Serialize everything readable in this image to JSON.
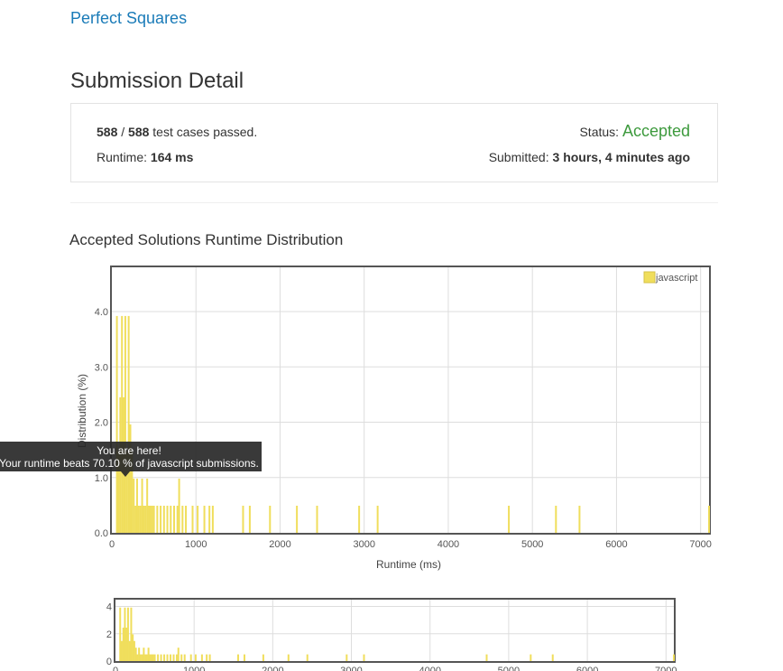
{
  "problem": {
    "title": "Perfect Squares"
  },
  "page_title": "Submission Detail",
  "summary": {
    "passed": "588",
    "slash": " / ",
    "total": "588",
    "passed_suffix": " test cases passed.",
    "runtime_label": "Runtime: ",
    "runtime_value": "164 ms",
    "status_label": "Status: ",
    "status_value": "Accepted",
    "submitted_label": "Submitted: ",
    "submitted_value": "3 hours, 4 minutes ago"
  },
  "colors": {
    "bar": "#f0de5c",
    "link": "#1a7bb8",
    "accepted": "#3d9a3d"
  },
  "distribution_title": "Accepted Solutions Runtime Distribution",
  "tooltip": {
    "line1": "You are here!",
    "line2": "Your runtime beats 70.10 % of javascript submissions."
  },
  "chart_data": [
    {
      "type": "bar",
      "xlabel": "Runtime (ms)",
      "ylabel": "Distribution (%)",
      "xlim": [
        0,
        7100
      ],
      "ylim": [
        0,
        4.8
      ],
      "xticks": [
        0,
        1000,
        2000,
        3000,
        4000,
        5000,
        6000,
        7000
      ],
      "yticks": [
        0.0,
        1.0,
        2.0,
        3.0,
        4.0
      ],
      "ytick_labels": [
        "0.0",
        "1.0",
        "2.0",
        "3.0",
        "4.0"
      ],
      "grid": true,
      "legend": "top-right",
      "series": [
        {
          "name": "javascript",
          "x": [
            60,
            80,
            100,
            120,
            140,
            160,
            180,
            200,
            220,
            240,
            260,
            280,
            300,
            320,
            340,
            360,
            380,
            400,
            420,
            440,
            460,
            480,
            500,
            540,
            580,
            620,
            660,
            700,
            740,
            780,
            800,
            840,
            880,
            960,
            1020,
            1100,
            1160,
            1200,
            1560,
            1640,
            1880,
            2200,
            2440,
            2940,
            3160,
            4720,
            5280,
            5560,
            7100
          ],
          "values": [
            3.92,
            1.47,
            2.45,
            3.92,
            2.45,
            3.92,
            1.47,
            3.92,
            1.96,
            1.47,
            0.98,
            0.49,
            0.98,
            0.49,
            0.49,
            0.98,
            0.49,
            0.49,
            0.98,
            0.49,
            0.49,
            0.49,
            0.49,
            0.49,
            0.49,
            0.49,
            0.49,
            0.49,
            0.49,
            0.49,
            0.98,
            0.49,
            0.49,
            0.49,
            0.49,
            0.49,
            0.49,
            0.49,
            0.49,
            0.49,
            0.49,
            0.49,
            0.49,
            0.49,
            0.49,
            0.49,
            0.49,
            0.49,
            0.49
          ]
        }
      ]
    },
    {
      "type": "bar",
      "xlim": [
        0,
        7100
      ],
      "ylim": [
        0,
        4.5
      ],
      "xticks": [
        0,
        1000,
        2000,
        3000,
        4000,
        5000,
        6000,
        7000
      ],
      "yticks": [
        0,
        2,
        4
      ],
      "ytick_labels": [
        "0",
        "2",
        "4"
      ],
      "grid": true,
      "series": [
        {
          "x": [],
          "values": []
        }
      ]
    }
  ]
}
